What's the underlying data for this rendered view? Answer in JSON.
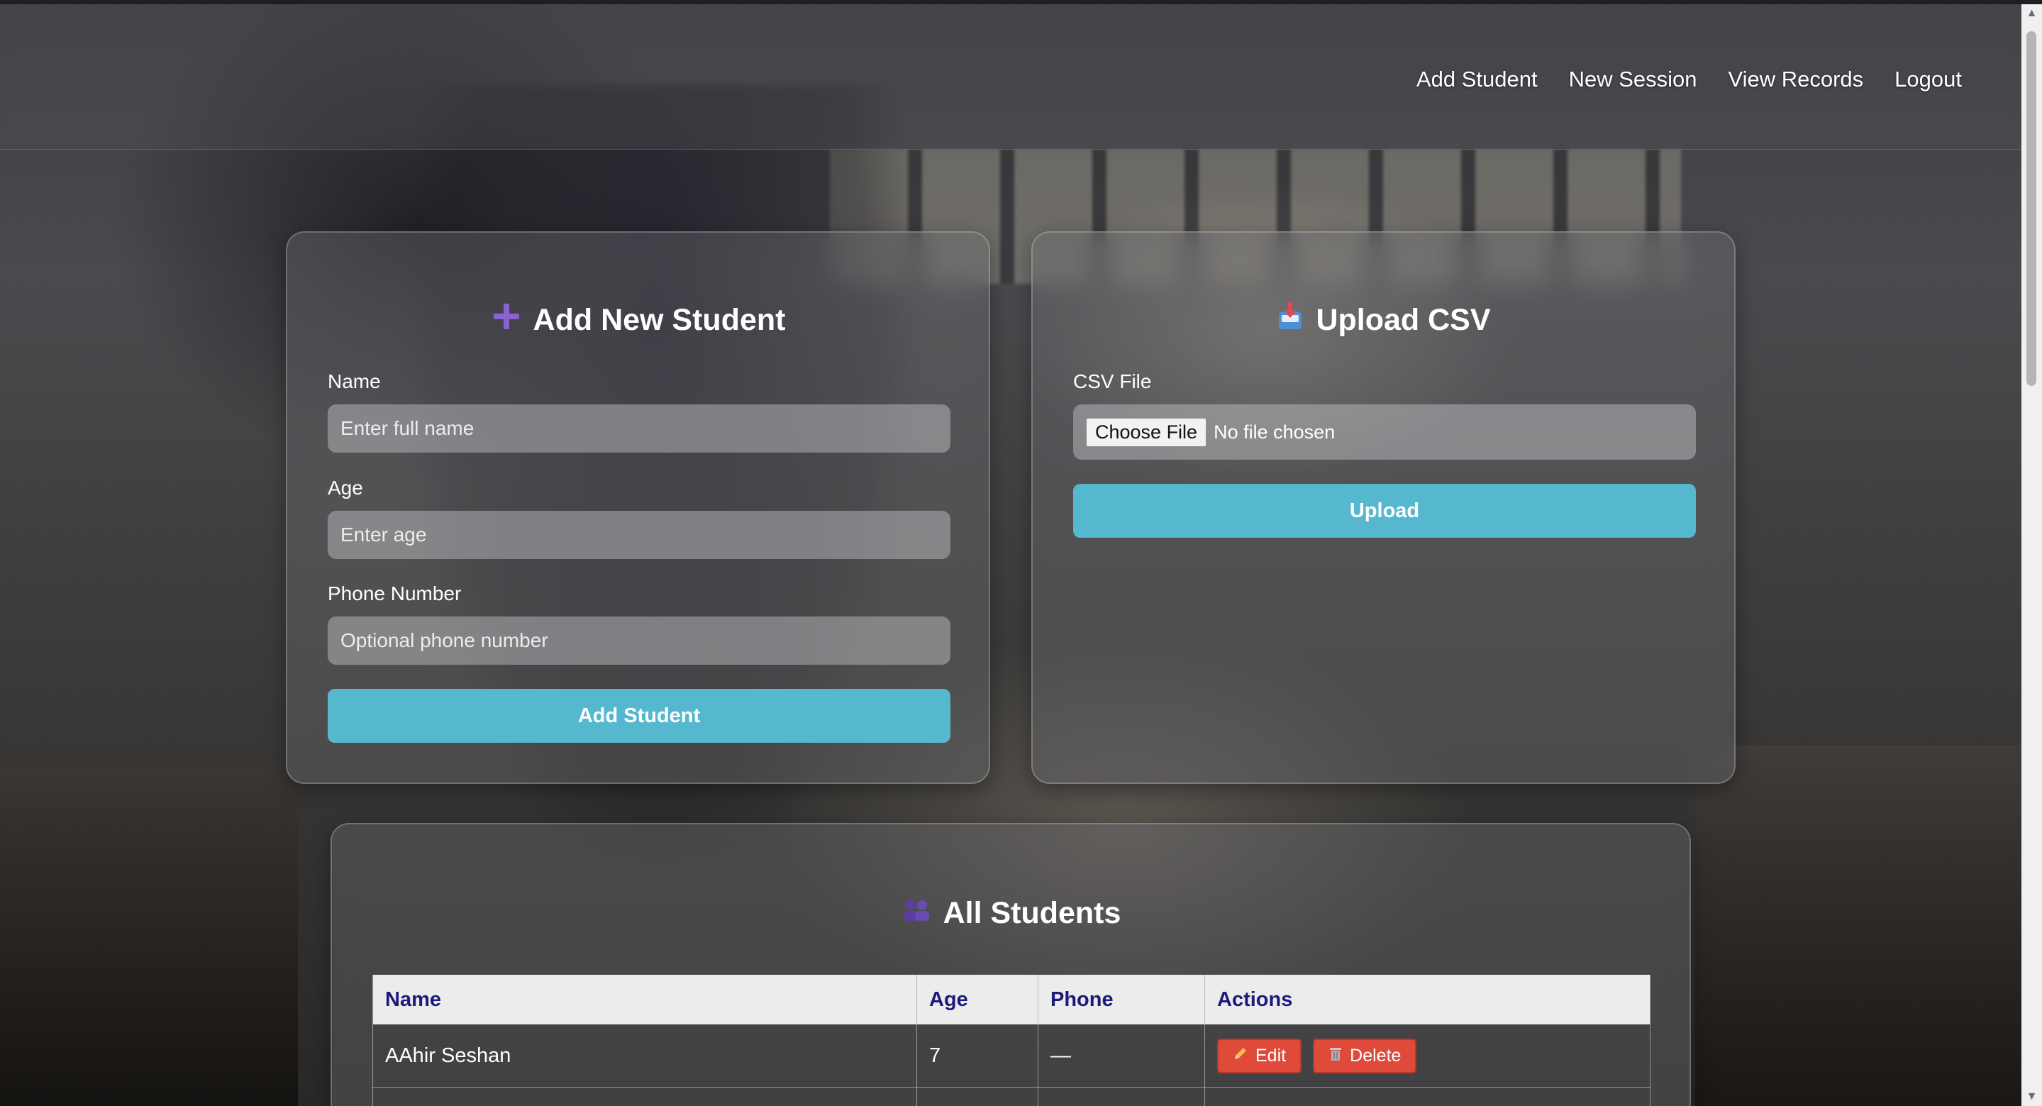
{
  "nav": {
    "items": [
      "Add Student",
      "New Session",
      "View Records",
      "Logout"
    ]
  },
  "add_student": {
    "title": "Add New Student",
    "icon": "plus-icon",
    "name_label": "Name",
    "name_placeholder": "Enter full name",
    "age_label": "Age",
    "age_placeholder": "Enter age",
    "phone_label": "Phone Number",
    "phone_placeholder": "Optional phone number",
    "submit_label": "Add Student"
  },
  "upload_csv": {
    "title": "Upload CSV",
    "icon": "inbox-tray-icon",
    "file_label": "CSV File",
    "choose_label": "Choose File",
    "file_status": "No file chosen",
    "submit_label": "Upload"
  },
  "all_students": {
    "title": "All Students",
    "icon": "people-icon",
    "columns": [
      "Name",
      "Age",
      "Phone",
      "Actions"
    ],
    "rows": [
      {
        "name": "AAhir Seshan",
        "age": "7",
        "phone": "—",
        "edit_label": "Edit",
        "delete_label": "Delete"
      }
    ]
  },
  "colors": {
    "accent": "#56b8cf",
    "danger": "#e04a3a",
    "table_header_text": "#1c1a7a"
  }
}
